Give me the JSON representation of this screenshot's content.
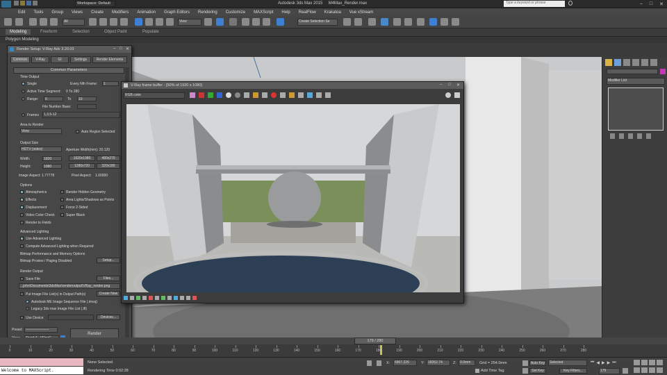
{
  "app": {
    "workspace_label": "Workspace: Default",
    "title": "Autodesk 3ds Max 2015",
    "filename": "M4Max_Render.max",
    "search_placeholder": "Type a keyword or phrase"
  },
  "menu": [
    "Edit",
    "Tools",
    "Group",
    "Views",
    "Create",
    "Modifiers",
    "Animation",
    "Graph Editors",
    "Rendering",
    "Customize",
    "MAXScript",
    "Help",
    "RealFlow",
    "Krakatoa",
    "Vue xStream"
  ],
  "toolbar": {
    "selection_filter": "All",
    "ref_coord": "View",
    "named_selection": "Create Selection Se"
  },
  "ribbon": {
    "tabs": [
      "Modeling",
      "Freeform",
      "Selection",
      "Object Paint",
      "Populate"
    ],
    "sub": "Polygon Modeling"
  },
  "render_setup": {
    "title": "Render Setup: V-Ray Adv 3.20.03",
    "tabs": [
      "Common",
      "V-Ray",
      "GI",
      "Settings",
      "Render Elements"
    ],
    "rollout": "Common Parameters",
    "time_output": {
      "label": "Time Output",
      "single": "Single",
      "every_nth": "Every Nth Frame:",
      "every_nth_value": "1",
      "active": "Active Time Segment:",
      "active_range": "0 To 280",
      "range": "Range:",
      "range_from": "0",
      "to": "To",
      "range_to": "10",
      "file_number_base": "File Number Base:",
      "frames": "Frames",
      "frames_value": "1,3,5-12"
    },
    "area": {
      "label": "Area to Render",
      "value": "View",
      "auto": "Auto Region Selected"
    },
    "output_size": {
      "label": "Output Size",
      "preset": "HDTV (video)",
      "aperture": "Aperture Width(mm): 20.120",
      "width_label": "Width:",
      "width": "1920",
      "height_label": "Height:",
      "height": "1080",
      "presets": [
        "1920x1080",
        "480x270",
        "1280x720",
        "320x180"
      ],
      "image_aspect": "Image Aspect: 1.77778",
      "pixel_aspect": "Pixel Aspect:",
      "pixel_aspect_value": "1.00000"
    },
    "options": {
      "label": "Options",
      "items": [
        "Atmospherics",
        "Render Hidden Geometry",
        "Effects",
        "Area Lights/Shadows as Points",
        "Displacement",
        "Force 2-Sided",
        "Video Color Check",
        "Super Black",
        "Render to Fields"
      ]
    },
    "adv_lighting": {
      "label": "Advanced Lighting",
      "use": "Use Advanced Lighting",
      "compute": "Compute Advanced Lighting when Required"
    },
    "bitmap": {
      "label": "Bitmap Performance and Memory Options",
      "value": "Bitmap Proxies / Paging Disabled",
      "setup": "Setup..."
    },
    "render_output": {
      "label": "Render Output",
      "save_file": "Save File",
      "files": "Files...",
      "path": "...john\\Documents\\3dsMax\\renderoutput\\VRay_render.png",
      "put_image": "Put Image File List(s) in Output Path(s)",
      "create_now": "Create Now",
      "autodesk_me": "Autodesk ME Image Sequence File (.imsq)",
      "legacy": "Legacy 3ds max Image File List (.ifl)",
      "use_device": "Use Device",
      "devices": "Devices..."
    },
    "footer": {
      "preset_label": "Preset:",
      "preset_value": "--------------------",
      "view_label": "View:",
      "view_value": "Quad 4 - VRayC",
      "render": "Render"
    }
  },
  "vfb": {
    "title": "V-Ray frame buffer - [50% of 1920 x 1080]",
    "channel": "RGB color"
  },
  "command_panel": {
    "modifier_list": "Modifier List"
  },
  "timeline": {
    "frame": "179 / 280",
    "ticks": [
      "0",
      "10",
      "20",
      "30",
      "40",
      "50",
      "60",
      "70",
      "80",
      "90",
      "100",
      "110",
      "120",
      "130",
      "140",
      "150",
      "160",
      "170",
      "180",
      "190",
      "200",
      "210",
      "220",
      "230",
      "240",
      "250",
      "260",
      "270",
      "280"
    ]
  },
  "status": {
    "maxscript": "Welcome to MAXScript.",
    "none_selected": "None Selected",
    "rendering_time": "Rendering Time  0:02:28",
    "x": "6907.226",
    "y": "18352.74",
    "z": "0.0mm",
    "grid": "Grid = 254.0mm",
    "add_time_tag": "Add Time Tag",
    "auto_key": "Auto Key",
    "selected": "Selected",
    "set_key": "Set Key",
    "key_filters": "Key Filters...",
    "frame": "179"
  }
}
